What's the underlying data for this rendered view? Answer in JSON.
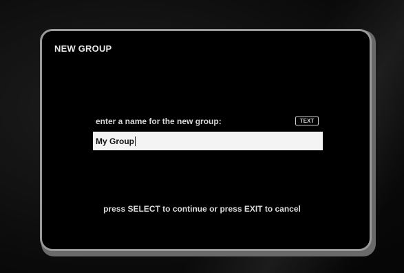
{
  "dialog": {
    "title": "NEW GROUP",
    "prompt": "enter a name for the new group:",
    "input_mode_badge": "TEXT",
    "name_value": "My Group",
    "footer_hint": "press SELECT to continue or press EXIT to cancel"
  }
}
